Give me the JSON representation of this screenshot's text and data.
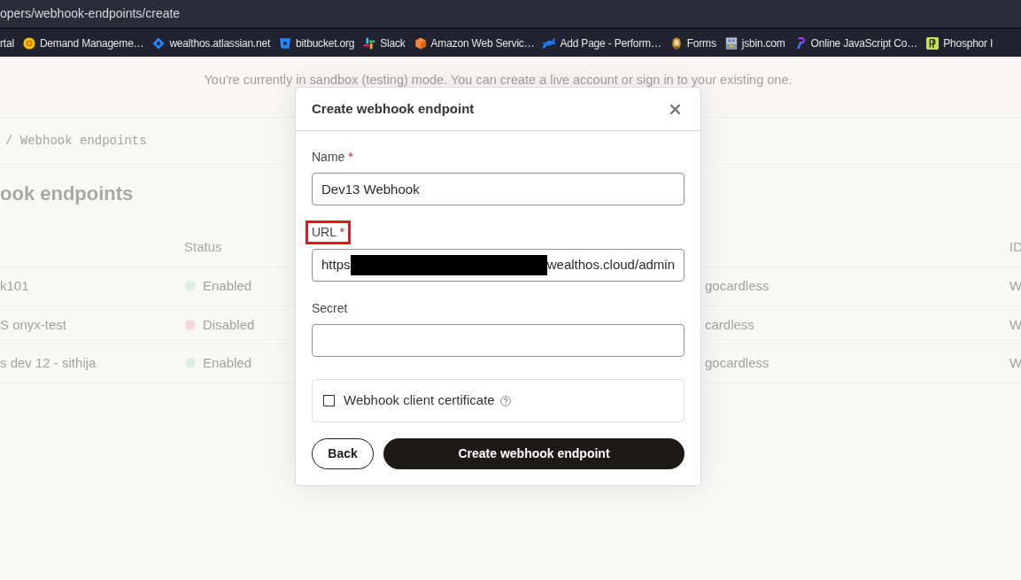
{
  "browser": {
    "address": "opers/webhook-endpoints/create",
    "bookmarks": [
      {
        "label": "rtal"
      },
      {
        "label": "Demand Manageme…"
      },
      {
        "label": "wealthos.atlassian.net"
      },
      {
        "label": "bitbucket.org"
      },
      {
        "label": "Slack"
      },
      {
        "label": "Amazon Web Servic…"
      },
      {
        "label": "Add Page - Perform…"
      },
      {
        "label": "Forms"
      },
      {
        "label": "jsbin.com"
      },
      {
        "label": "Online JavaScript Co…"
      },
      {
        "label": "Phosphor I"
      }
    ]
  },
  "banner": {
    "text": "You're currently in sandbox (testing) mode. You can create a live account or sign in to your existing one."
  },
  "breadcrumb": "/ Webhook endpoints",
  "heading": "ook endpoints",
  "table": {
    "status_header": "Status",
    "id_header": "ID",
    "rows": [
      {
        "name": "k101",
        "status": "Enabled",
        "color": "#dcefe7",
        "column_3": "gocardless",
        "id": "W"
      },
      {
        "name": "S onyx-test",
        "status": "Disabled",
        "color": "#f6dada",
        "column_3": "cardless",
        "id": "W"
      },
      {
        "name": "s dev 12 - sithija",
        "status": "Enabled",
        "color": "#dcefe7",
        "column_3": "gocardless",
        "id": "W"
      }
    ]
  },
  "modal": {
    "title": "Create webhook endpoint",
    "fields": [
      {
        "kind": "text",
        "label": "Name",
        "required_mark": "*",
        "highlighted": false,
        "value": "Dev13 Webhook"
      },
      {
        "kind": "redacted_text",
        "label": "URL",
        "required_mark": "*",
        "highlighted": true,
        "value_parts": [
          {
            "kind": "text",
            "text": "https"
          },
          {
            "kind": "redacted"
          },
          {
            "kind": "text",
            "text": "wealthos.cloud/admin"
          }
        ]
      },
      {
        "kind": "text",
        "label": "Secret",
        "highlighted": false
      }
    ],
    "certificate": {
      "label": "Webhook client certificate",
      "checked": false
    },
    "buttons": [
      {
        "kind": "back",
        "label": "Back"
      },
      {
        "kind": "submit",
        "label": "Create webhook endpoint"
      }
    ]
  }
}
